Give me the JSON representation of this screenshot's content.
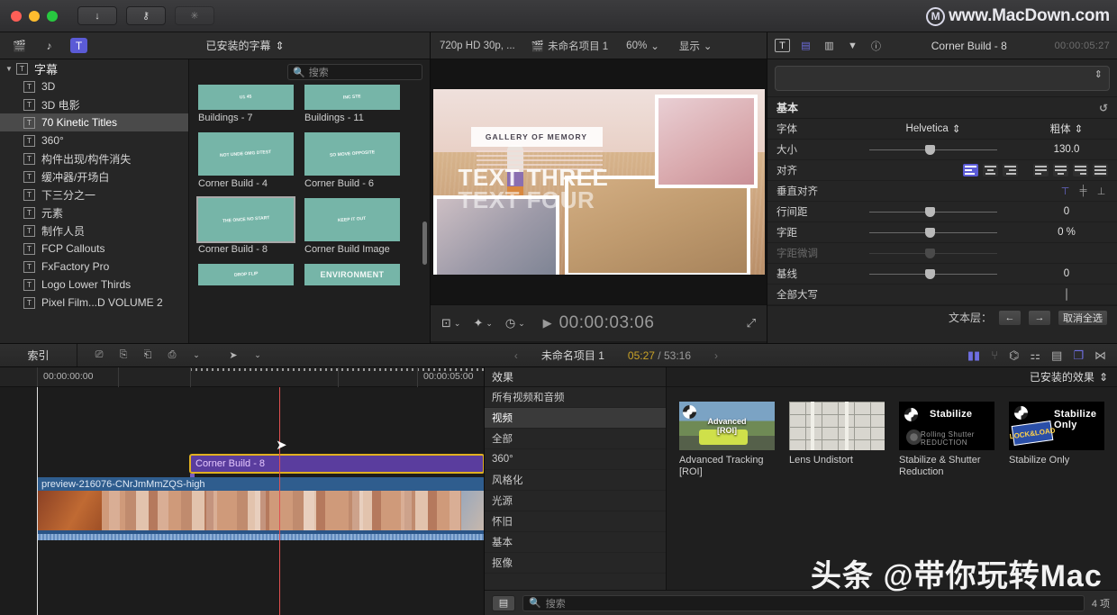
{
  "window": {
    "toolbar_buttons": [
      "download-icon",
      "key-icon",
      "effects-icon"
    ],
    "watermark_top": "www.MacDown.com",
    "watermark_logo": "M",
    "watermark_bottom": "头条 @带你玩转Mac"
  },
  "browser": {
    "icons": [
      "library-icon",
      "photos-audio-icon",
      "titles-generators-icon"
    ],
    "title": "已安装的字幕",
    "search_placeholder": "搜索",
    "sidebar": [
      {
        "label": "字幕",
        "root": true,
        "selected": false
      },
      {
        "label": "3D",
        "root": false,
        "selected": false
      },
      {
        "label": "3D 电影",
        "root": false,
        "selected": false
      },
      {
        "label": "70 Kinetic Titles",
        "root": false,
        "selected": true
      },
      {
        "label": "360°",
        "root": false,
        "selected": false
      },
      {
        "label": "构件出现/构件消失",
        "root": false,
        "selected": false
      },
      {
        "label": "缓冲器/开场白",
        "root": false,
        "selected": false
      },
      {
        "label": "下三分之一",
        "root": false,
        "selected": false
      },
      {
        "label": "元素",
        "root": false,
        "selected": false
      },
      {
        "label": "制作人员",
        "root": false,
        "selected": false
      },
      {
        "label": "FCP Callouts",
        "root": false,
        "selected": false
      },
      {
        "label": "FxFactory Pro",
        "root": false,
        "selected": false
      },
      {
        "label": "Logo Lower Thirds",
        "root": false,
        "selected": false
      },
      {
        "label": "Pixel Film...D VOLUME 2",
        "root": false,
        "selected": false
      }
    ],
    "items": [
      {
        "label": "Buildings - 7",
        "art": "U1 45",
        "selected": false,
        "big": false
      },
      {
        "label": "Buildings - 11",
        "art": "INC STE",
        "selected": false,
        "big": false
      },
      {
        "label": "Corner Build - 4",
        "art": "NOT UNDE OMG DTEST",
        "selected": false,
        "big": false
      },
      {
        "label": "Corner Build - 6",
        "art": "SO MOVE OPPOSITE",
        "selected": false,
        "big": false
      },
      {
        "label": "Corner Build - 8",
        "art": "THE ONCE NO START",
        "selected": true,
        "big": false
      },
      {
        "label": "Corner Build Image",
        "art": "KEEP IT OUT",
        "selected": false,
        "big": false
      },
      {
        "label": "",
        "art": "DROP FLIP",
        "selected": false,
        "big": false
      },
      {
        "label": "",
        "art": "ENVIRONMENT",
        "selected": false,
        "big": true
      }
    ]
  },
  "viewer": {
    "format": "720p HD 30p, ...",
    "project_icon": "clapperboard-icon",
    "project_name": "未命名项目 1",
    "zoom": "60%",
    "display_menu": "显示",
    "timecode": "00:00:03:06",
    "content": {
      "title_box": "GALLERY OF MEMORY",
      "text_line1": "TEXT THREE",
      "text_line2": "TEXT FOUR"
    },
    "bottom_icons": [
      "crop-icon",
      "effects-wand-icon",
      "retime-icon",
      "play-icon",
      "fullscreen-icon"
    ]
  },
  "inspector": {
    "tabs": [
      "text-icon",
      "title-icon",
      "video-icon",
      "generator-icon",
      "info-icon"
    ],
    "clip_name": "Corner Build - 8",
    "timecode": "00:00:05:27",
    "preset_value": "",
    "section_title": "基本",
    "reset_icon": "reset-icon",
    "rows": [
      {
        "label": "字体",
        "type": "popup",
        "value": "Helvetica",
        "value2": "粗体"
      },
      {
        "label": "大小",
        "type": "slider",
        "value": "130.0",
        "knob": 44
      },
      {
        "label": "对齐",
        "type": "align"
      },
      {
        "label": "垂直对齐",
        "type": "valign"
      },
      {
        "label": "行间距",
        "type": "slider",
        "value": "0",
        "knob": 44
      },
      {
        "label": "字距",
        "type": "slider",
        "value": "0 %",
        "knob": 44
      },
      {
        "label": "字距微调",
        "type": "slider",
        "value": "",
        "knob": 44,
        "dim": true
      },
      {
        "label": "基线",
        "type": "slider",
        "value": "0",
        "knob": 44
      },
      {
        "label": "全部大写",
        "type": "checkbox",
        "checked": false
      }
    ],
    "footer_label": "文本层：",
    "footer_prev": "←",
    "footer_next": "→",
    "footer_deselect": "取消全选"
  },
  "timeline_toolbar": {
    "index_label": "索引",
    "tools": [
      "append-icon",
      "insert-icon",
      "overwrite-icon",
      "connect-icon",
      "select-tool-icon"
    ],
    "project_name": "未命名项目 1",
    "playhead_time": "05:27",
    "total_time": "53:16",
    "right_icons": [
      "audio-meter-icon",
      "waveform-icon",
      "headphone-icon",
      "audio-mix-icon",
      "index-icon",
      "browser-toggle-icon",
      "timeline-toggle-icon"
    ]
  },
  "timeline": {
    "ruler_start": "00:00:00:00",
    "ruler_mark": "00:00:05:00",
    "title_clip": "Corner Build - 8",
    "video_clip": "preview-216076-CNrJmMmZQS-high"
  },
  "effects": {
    "header": "效果",
    "categories": [
      {
        "label": "所有视频和音频",
        "selected": false
      },
      {
        "label": "视频",
        "selected": true
      },
      {
        "label": "全部",
        "selected": false
      },
      {
        "label": "360°",
        "selected": false
      },
      {
        "label": "风格化",
        "selected": false
      },
      {
        "label": "光源",
        "selected": false
      },
      {
        "label": "怀旧",
        "selected": false
      },
      {
        "label": "基本",
        "selected": false
      },
      {
        "label": "抠像",
        "selected": false
      }
    ],
    "installed_label": "已安装的效果",
    "items": [
      {
        "label": "Advanced Tracking [ROI]",
        "art": "Advanced\n[ROI]"
      },
      {
        "label": "Lens Undistort",
        "art": ""
      },
      {
        "label": "Stabilize & Shutter Reduction",
        "art": "Stabilize",
        "sub": "Rolling Shutter REDUCTION"
      },
      {
        "label": "Stabilize Only",
        "art": "Stabilize Only",
        "sub": "LOCK & LOAD"
      }
    ],
    "search_placeholder": "搜索",
    "count": "4 项"
  }
}
